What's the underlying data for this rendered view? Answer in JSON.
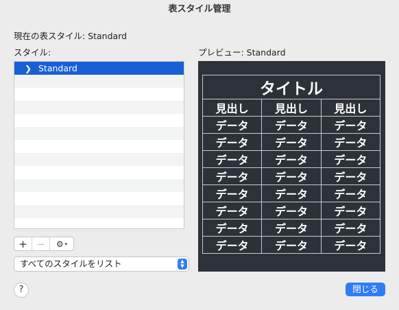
{
  "window": {
    "title": "表スタイル管理"
  },
  "current_style_text": "現在の表スタイル: Standard",
  "styles_label": "スタイル:",
  "style_list": {
    "items": [
      {
        "label": "Standard",
        "selected": true
      }
    ]
  },
  "list_buttons": {
    "add": "+",
    "remove": "−",
    "gear": "⚙",
    "gear_caret": "▾"
  },
  "filter_popup": {
    "value": "すべてのスタイルをリスト",
    "arrows": "▲▼"
  },
  "preview": {
    "label": "プレビュー: Standard",
    "table": {
      "title": "タイトル",
      "headers": [
        "見出し",
        "見出し",
        "見出し"
      ],
      "rows": [
        [
          "データ",
          "データ",
          "データ"
        ],
        [
          "データ",
          "データ",
          "データ"
        ],
        [
          "データ",
          "データ",
          "データ"
        ],
        [
          "データ",
          "データ",
          "データ"
        ],
        [
          "データ",
          "データ",
          "データ"
        ],
        [
          "データ",
          "データ",
          "データ"
        ],
        [
          "データ",
          "データ",
          "データ"
        ],
        [
          "データ",
          "データ",
          "データ"
        ]
      ]
    }
  },
  "help_button": "?",
  "close_button": "閉じる",
  "colors": {
    "accent": "#2f7cf6",
    "selection": "#1960d6",
    "preview_bg": "#2d3238"
  }
}
